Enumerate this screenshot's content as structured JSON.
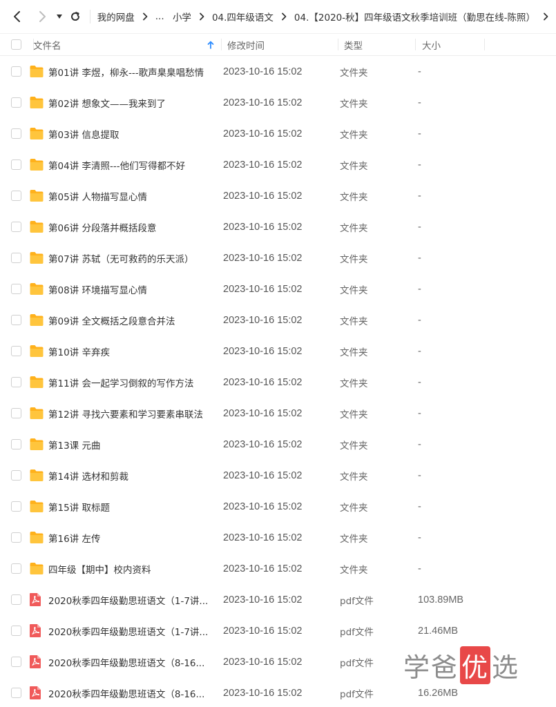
{
  "breadcrumb": {
    "items": [
      "我的网盘",
      "...",
      "小学",
      "04.四年级语文",
      "04.【2020-秋】四年级语文秋季培训班（勤思在线-陈照）"
    ]
  },
  "table": {
    "headers": {
      "name": "文件名",
      "modified": "修改时间",
      "type": "类型",
      "size": "大小"
    },
    "rows": [
      {
        "name": "第01讲 李煜，柳永---歌声臬臬唱愁情",
        "modified": "2023-10-16 15:02",
        "type": "文件夹",
        "size": "-",
        "icon": "folder-icon"
      },
      {
        "name": "第02讲 想象文——我来到了",
        "modified": "2023-10-16 15:02",
        "type": "文件夹",
        "size": "-",
        "icon": "folder-icon"
      },
      {
        "name": "第03讲 信息提取",
        "modified": "2023-10-16 15:02",
        "type": "文件夹",
        "size": "-",
        "icon": "folder-icon"
      },
      {
        "name": "第04讲 李清照---他们写得都不好",
        "modified": "2023-10-16 15:02",
        "type": "文件夹",
        "size": "-",
        "icon": "folder-icon"
      },
      {
        "name": "第05讲 人物描写显心情",
        "modified": "2023-10-16 15:02",
        "type": "文件夹",
        "size": "-",
        "icon": "folder-icon"
      },
      {
        "name": "第06讲 分段落并概括段意",
        "modified": "2023-10-16 15:02",
        "type": "文件夹",
        "size": "-",
        "icon": "folder-icon"
      },
      {
        "name": "第07讲 苏轼（无可救药的乐天派）",
        "modified": "2023-10-16 15:02",
        "type": "文件夹",
        "size": "-",
        "icon": "folder-icon"
      },
      {
        "name": "第08讲 环境描写显心情",
        "modified": "2023-10-16 15:02",
        "type": "文件夹",
        "size": "-",
        "icon": "folder-icon"
      },
      {
        "name": "第09讲 全文概括之段意合并法",
        "modified": "2023-10-16 15:02",
        "type": "文件夹",
        "size": "-",
        "icon": "folder-icon"
      },
      {
        "name": "第10讲 辛弃疾",
        "modified": "2023-10-16 15:02",
        "type": "文件夹",
        "size": "-",
        "icon": "folder-icon"
      },
      {
        "name": "第11讲 会一起学习倒叙的写作方法",
        "modified": "2023-10-16 15:02",
        "type": "文件夹",
        "size": "-",
        "icon": "folder-icon"
      },
      {
        "name": "第12讲 寻找六要素和学习要素串联法",
        "modified": "2023-10-16 15:02",
        "type": "文件夹",
        "size": "-",
        "icon": "folder-icon"
      },
      {
        "name": "第13课 元曲",
        "modified": "2023-10-16 15:02",
        "type": "文件夹",
        "size": "-",
        "icon": "folder-icon"
      },
      {
        "name": "第14讲 选材和剪裁",
        "modified": "2023-10-16 15:02",
        "type": "文件夹",
        "size": "-",
        "icon": "folder-icon"
      },
      {
        "name": "第15讲 取标题",
        "modified": "2023-10-16 15:02",
        "type": "文件夹",
        "size": "-",
        "icon": "folder-icon"
      },
      {
        "name": "第16讲 左传",
        "modified": "2023-10-16 15:02",
        "type": "文件夹",
        "size": "-",
        "icon": "folder-icon"
      },
      {
        "name": "四年级【期中】校内资料",
        "modified": "2023-10-16 15:02",
        "type": "文件夹",
        "size": "-",
        "icon": "folder-icon"
      },
      {
        "name": "2020秋季四年级勤思班语文（1-7讲...",
        "modified": "2023-10-16 15:02",
        "type": "pdf文件",
        "size": "103.89MB",
        "icon": "pdf-icon"
      },
      {
        "name": "2020秋季四年级勤思班语文（1-7讲...",
        "modified": "2023-10-16 15:02",
        "type": "pdf文件",
        "size": "21.46MB",
        "icon": "pdf-icon"
      },
      {
        "name": "2020秋季四年级勤思班语文（8-16...",
        "modified": "2023-10-16 15:02",
        "type": "pdf文件",
        "size": "",
        "icon": "pdf-icon"
      },
      {
        "name": "2020秋季四年级勤思班语文（8-16...",
        "modified": "2023-10-16 15:02",
        "type": "pdf文件",
        "size": "16.26MB",
        "icon": "pdf-icon"
      }
    ]
  },
  "watermark": {
    "part1": "学爸",
    "part2": "优",
    "part3": "选"
  },
  "colors": {
    "folder": "#FFC53D",
    "folder_tab": "#FFB11B",
    "pdf": "#F05A5A",
    "sort_arrow": "#2D8CFF"
  }
}
